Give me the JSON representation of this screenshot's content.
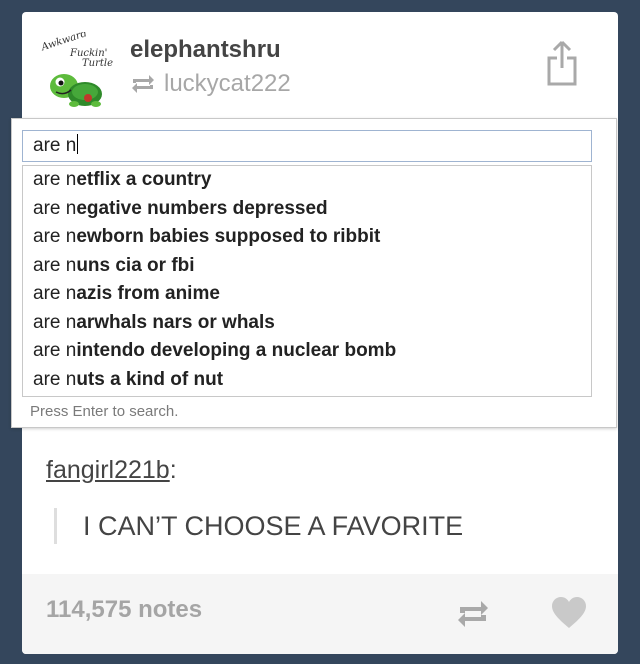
{
  "post": {
    "blog_name": "elephantshru",
    "reblogged_from": "luckycat222",
    "avatar": {
      "text_line1": "Awkward",
      "text_line2": "Fuckin'",
      "text_line3": "Turtle"
    }
  },
  "search": {
    "query": "are n",
    "suggestion_prefix": "are n",
    "suggestions": [
      {
        "prefix": "are n",
        "completion": "etflix a country"
      },
      {
        "prefix": "are n",
        "completion": "egative numbers depressed"
      },
      {
        "prefix": "are n",
        "completion": "ewborn babies supposed to ribbit"
      },
      {
        "prefix": "are n",
        "completion": "uns cia or fbi"
      },
      {
        "prefix": "are n",
        "completion": "azis from anime"
      },
      {
        "prefix": "are n",
        "completion": "arwhals nars or whals"
      },
      {
        "prefix": "are n",
        "completion": "intendo developing a nuclear bomb"
      },
      {
        "prefix": "are n",
        "completion": "uts a kind of nut"
      }
    ],
    "hint": "Press Enter to search."
  },
  "reblog": {
    "username": "fangirl221b",
    "colon": ":",
    "quote": "I CAN’T CHOOSE A FAVORITE"
  },
  "footer": {
    "notes": "114,575 notes"
  },
  "colors": {
    "background": "#34465c",
    "card": "#ffffff",
    "footer": "#f5f5f5",
    "muted_text": "#a5a5a5",
    "input_border": "#9fb4d1",
    "avatar_green": "#5dbb3c"
  },
  "icons": {
    "share": "share-icon",
    "reblog": "reblog-icon",
    "heart": "heart-icon"
  }
}
